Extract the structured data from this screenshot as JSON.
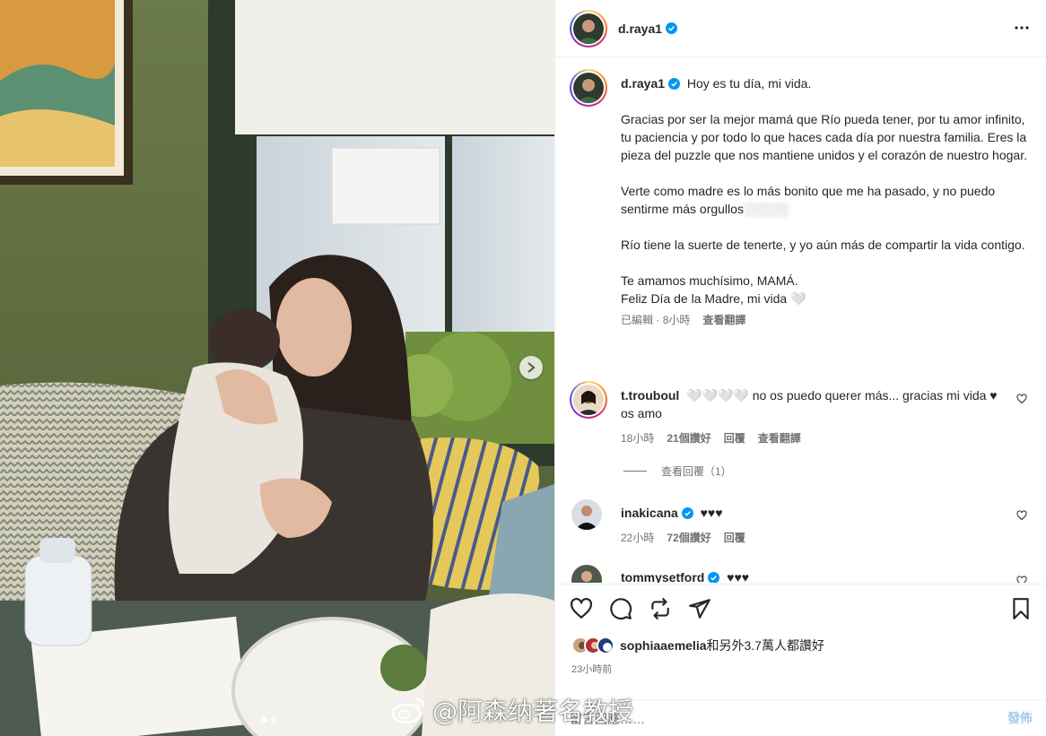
{
  "post": {
    "author": "d.raya1",
    "caption_lines": [
      "Hoy es tu día, mi vida.",
      "Gracias por ser la mejor mamá que Río pueda tener, por tu amor infinito, tu paciencia y por todo lo que haces cada día por nuestra familia. Eres la pieza del puzzle que nos mantiene unidos y el corazón de nuestro hogar.",
      "Verte como madre es lo más bonito que me ha pasado, y no puedo sentirme más orgullos",
      "Río tiene la suerte de tenerte, y yo aún más de compartir la vida contigo.",
      "Te amamos muchísimo, MAMÁ.",
      "Feliz Día de la Madre, mi vida 🤍"
    ],
    "caption_meta": {
      "edited": "已編輯",
      "sep": "·",
      "time": "8小時",
      "see_translation": "查看翻譯"
    }
  },
  "comments": [
    {
      "user": "t.trouboul",
      "text": "🤍🤍🤍🤍 no os puedo querer más... gracias mi vida ♥ os amo",
      "time": "18小時",
      "likes": "21個讚好",
      "reply": "回覆",
      "see_translation": "查看翻譯",
      "view_replies": "查看回覆（1）"
    },
    {
      "user": "inakicana",
      "verified": true,
      "text": "♥♥♥",
      "time": "22小時",
      "likes": "72個讚好",
      "reply": "回覆"
    },
    {
      "user": "tommysetford",
      "verified": true,
      "text": "♥♥♥"
    }
  ],
  "actions": {
    "liked_by": "sophiaaemelia",
    "liked_suffix": "和另外3.7萬人都讚好",
    "timestamp": "23小時前",
    "comment_placeholder": "留言回應……",
    "post_label": "發佈"
  },
  "watermark": "@阿森纳著名教授",
  "icons": {
    "verified": "verified-badge-icon",
    "more": "more-options-icon",
    "like": "heart-icon",
    "comment": "comment-icon",
    "share": "share-icon",
    "save": "bookmark-icon",
    "next": "chevron-right-icon"
  },
  "colors": {
    "verified": "#0095f6",
    "post_disabled": "#a3c7f0",
    "muted": "#737373"
  }
}
